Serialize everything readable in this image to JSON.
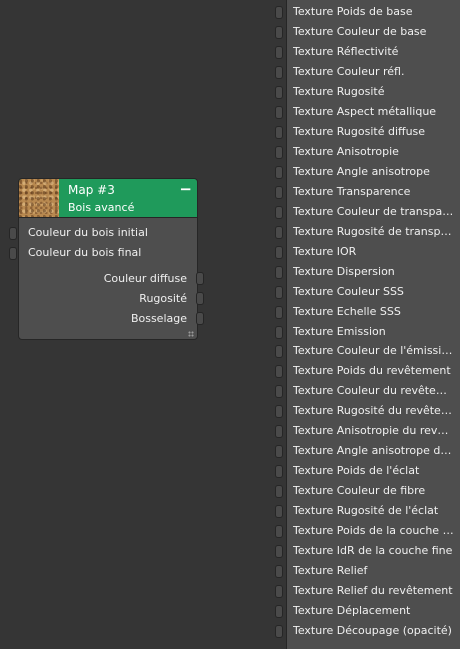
{
  "node": {
    "title": "Map #3",
    "subtitle": "Bois avancé",
    "collapse_label": "−",
    "thumbnail": "wood-texture-thumbnail",
    "header_color": "#1f9a5b",
    "inputs": [
      {
        "label": "Couleur du bois initial"
      },
      {
        "label": "Couleur du bois final"
      }
    ],
    "outputs": [
      {
        "label": "Couleur diffuse"
      },
      {
        "label": "Rugosité"
      },
      {
        "label": "Bosselage"
      }
    ]
  },
  "panel": {
    "inputs": [
      {
        "label": "Texture Poids de base"
      },
      {
        "label": "Texture Couleur de base"
      },
      {
        "label": "Texture Réflectivité"
      },
      {
        "label": "Texture Couleur réfl."
      },
      {
        "label": "Texture Rugosité"
      },
      {
        "label": "Texture Aspect métallique"
      },
      {
        "label": "Texture Rugosité diffuse"
      },
      {
        "label": "Texture Anisotropie"
      },
      {
        "label": "Texture Angle anisotrope"
      },
      {
        "label": "Texture Transparence"
      },
      {
        "label": "Texture Couleur de transparence"
      },
      {
        "label": "Texture Rugosité de transparence"
      },
      {
        "label": "Texture IOR"
      },
      {
        "label": "Texture Dispersion"
      },
      {
        "label": "Texture Couleur SSS"
      },
      {
        "label": "Texture Echelle SSS"
      },
      {
        "label": "Texture Emission"
      },
      {
        "label": "Texture Couleur de l'émission"
      },
      {
        "label": "Texture Poids du revêtement"
      },
      {
        "label": "Texture Couleur du revêtement"
      },
      {
        "label": "Texture Rugosité du revêtement"
      },
      {
        "label": "Texture Anisotropie du revêtement"
      },
      {
        "label": "Texture Angle anisotrope du revêtement"
      },
      {
        "label": "Texture Poids de l'éclat"
      },
      {
        "label": "Texture Couleur de fibre"
      },
      {
        "label": "Texture Rugosité de l'éclat"
      },
      {
        "label": "Texture Poids de la couche fine"
      },
      {
        "label": "Texture IdR de la couche fine"
      },
      {
        "label": "Texture Relief"
      },
      {
        "label": "Texture Relief du revêtement"
      },
      {
        "label": "Texture Déplacement"
      },
      {
        "label": "Texture Découpage (opacité)"
      }
    ]
  }
}
